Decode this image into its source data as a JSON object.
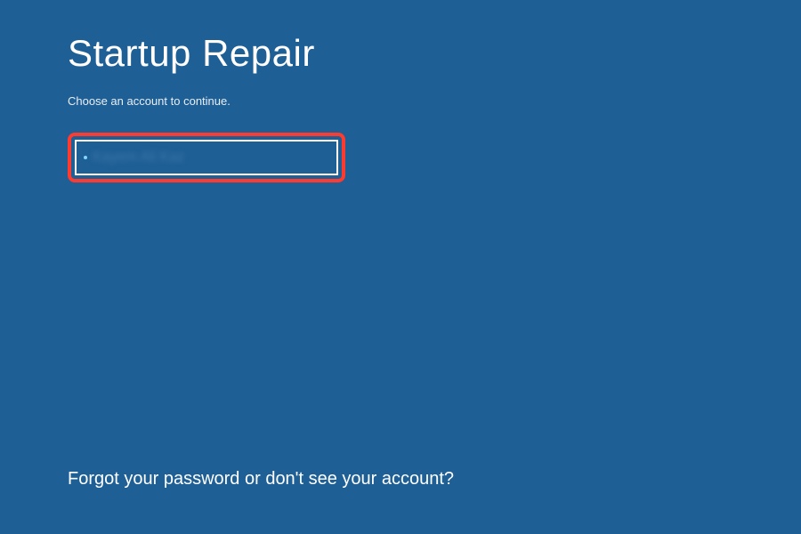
{
  "header": {
    "title": "Startup Repair",
    "subtitle": "Choose an account to continue."
  },
  "account": {
    "name": "Kayem Ali Kaz"
  },
  "footer": {
    "forgot": "Forgot your password or don't see your account?"
  }
}
